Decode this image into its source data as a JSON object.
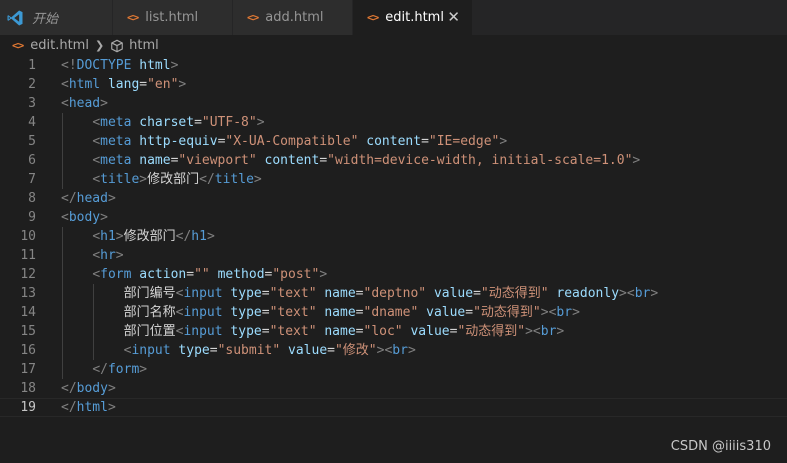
{
  "tabs": [
    {
      "label": "开始",
      "active": false,
      "icon": "vscode-logo-icon"
    },
    {
      "label": "list.html",
      "active": false,
      "icon": "html-file-icon"
    },
    {
      "label": "add.html",
      "active": false,
      "icon": "html-file-icon"
    },
    {
      "label": "edit.html",
      "active": true,
      "icon": "html-file-icon"
    }
  ],
  "breadcrumb": {
    "file": "edit.html",
    "symbol": "html"
  },
  "editor": {
    "current_line": 19,
    "lines": [
      [
        [
          "punc",
          "<!"
        ],
        [
          "tag",
          "DOCTYPE"
        ],
        [
          "text",
          " "
        ],
        [
          "attr",
          "html"
        ],
        [
          "punc",
          ">"
        ]
      ],
      [
        [
          "punc",
          "<"
        ],
        [
          "tag",
          "html"
        ],
        [
          "text",
          " "
        ],
        [
          "attr",
          "lang"
        ],
        [
          "text",
          "="
        ],
        [
          "str",
          "\"en\""
        ],
        [
          "punc",
          ">"
        ]
      ],
      [
        [
          "punc",
          "<"
        ],
        [
          "tag",
          "head"
        ],
        [
          "punc",
          ">"
        ]
      ],
      [
        [
          "text",
          "    "
        ],
        [
          "punc",
          "<"
        ],
        [
          "tag",
          "meta"
        ],
        [
          "text",
          " "
        ],
        [
          "attr",
          "charset"
        ],
        [
          "text",
          "="
        ],
        [
          "str",
          "\"UTF-8\""
        ],
        [
          "punc",
          ">"
        ]
      ],
      [
        [
          "text",
          "    "
        ],
        [
          "punc",
          "<"
        ],
        [
          "tag",
          "meta"
        ],
        [
          "text",
          " "
        ],
        [
          "attr",
          "http-equiv"
        ],
        [
          "text",
          "="
        ],
        [
          "str",
          "\"X-UA-Compatible\""
        ],
        [
          "text",
          " "
        ],
        [
          "attr",
          "content"
        ],
        [
          "text",
          "="
        ],
        [
          "str",
          "\"IE=edge\""
        ],
        [
          "punc",
          ">"
        ]
      ],
      [
        [
          "text",
          "    "
        ],
        [
          "punc",
          "<"
        ],
        [
          "tag",
          "meta"
        ],
        [
          "text",
          " "
        ],
        [
          "attr",
          "name"
        ],
        [
          "text",
          "="
        ],
        [
          "str",
          "\"viewport\""
        ],
        [
          "text",
          " "
        ],
        [
          "attr",
          "content"
        ],
        [
          "text",
          "="
        ],
        [
          "str",
          "\"width=device-width, initial-scale=1.0\""
        ],
        [
          "punc",
          ">"
        ]
      ],
      [
        [
          "text",
          "    "
        ],
        [
          "punc",
          "<"
        ],
        [
          "tag",
          "title"
        ],
        [
          "punc",
          ">"
        ],
        [
          "text",
          "修改部门"
        ],
        [
          "punc",
          "</"
        ],
        [
          "tag",
          "title"
        ],
        [
          "punc",
          ">"
        ]
      ],
      [
        [
          "punc",
          "</"
        ],
        [
          "tag",
          "head"
        ],
        [
          "punc",
          ">"
        ]
      ],
      [
        [
          "punc",
          "<"
        ],
        [
          "tag",
          "body"
        ],
        [
          "punc",
          ">"
        ]
      ],
      [
        [
          "text",
          "    "
        ],
        [
          "punc",
          "<"
        ],
        [
          "tag",
          "h1"
        ],
        [
          "punc",
          ">"
        ],
        [
          "text",
          "修改部门"
        ],
        [
          "punc",
          "</"
        ],
        [
          "tag",
          "h1"
        ],
        [
          "punc",
          ">"
        ]
      ],
      [
        [
          "text",
          "    "
        ],
        [
          "punc",
          "<"
        ],
        [
          "tag",
          "hr"
        ],
        [
          "punc",
          ">"
        ]
      ],
      [
        [
          "text",
          "    "
        ],
        [
          "punc",
          "<"
        ],
        [
          "tag",
          "form"
        ],
        [
          "text",
          " "
        ],
        [
          "attr",
          "action"
        ],
        [
          "text",
          "="
        ],
        [
          "str",
          "\"\""
        ],
        [
          "text",
          " "
        ],
        [
          "attr",
          "method"
        ],
        [
          "text",
          "="
        ],
        [
          "str",
          "\"post\""
        ],
        [
          "punc",
          ">"
        ]
      ],
      [
        [
          "text",
          "        部门编号"
        ],
        [
          "punc",
          "<"
        ],
        [
          "tag",
          "input"
        ],
        [
          "text",
          " "
        ],
        [
          "attr",
          "type"
        ],
        [
          "text",
          "="
        ],
        [
          "str",
          "\"text\""
        ],
        [
          "text",
          " "
        ],
        [
          "attr",
          "name"
        ],
        [
          "text",
          "="
        ],
        [
          "str",
          "\"deptno\""
        ],
        [
          "text",
          " "
        ],
        [
          "attr",
          "value"
        ],
        [
          "text",
          "="
        ],
        [
          "str",
          "\"动态得到\""
        ],
        [
          "text",
          " "
        ],
        [
          "attr",
          "readonly"
        ],
        [
          "punc",
          "><"
        ],
        [
          "tag",
          "br"
        ],
        [
          "punc",
          ">"
        ]
      ],
      [
        [
          "text",
          "        部门名称"
        ],
        [
          "punc",
          "<"
        ],
        [
          "tag",
          "input"
        ],
        [
          "text",
          " "
        ],
        [
          "attr",
          "type"
        ],
        [
          "text",
          "="
        ],
        [
          "str",
          "\"text\""
        ],
        [
          "text",
          " "
        ],
        [
          "attr",
          "name"
        ],
        [
          "text",
          "="
        ],
        [
          "str",
          "\"dname\""
        ],
        [
          "text",
          " "
        ],
        [
          "attr",
          "value"
        ],
        [
          "text",
          "="
        ],
        [
          "str",
          "\"动态得到\""
        ],
        [
          "punc",
          "><"
        ],
        [
          "tag",
          "br"
        ],
        [
          "punc",
          ">"
        ]
      ],
      [
        [
          "text",
          "        部门位置"
        ],
        [
          "punc",
          "<"
        ],
        [
          "tag",
          "input"
        ],
        [
          "text",
          " "
        ],
        [
          "attr",
          "type"
        ],
        [
          "text",
          "="
        ],
        [
          "str",
          "\"text\""
        ],
        [
          "text",
          " "
        ],
        [
          "attr",
          "name"
        ],
        [
          "text",
          "="
        ],
        [
          "str",
          "\"loc\""
        ],
        [
          "text",
          " "
        ],
        [
          "attr",
          "value"
        ],
        [
          "text",
          "="
        ],
        [
          "str",
          "\"动态得到\""
        ],
        [
          "punc",
          "><"
        ],
        [
          "tag",
          "br"
        ],
        [
          "punc",
          ">"
        ]
      ],
      [
        [
          "text",
          "        "
        ],
        [
          "punc",
          "<"
        ],
        [
          "tag",
          "input"
        ],
        [
          "text",
          " "
        ],
        [
          "attr",
          "type"
        ],
        [
          "text",
          "="
        ],
        [
          "str",
          "\"submit\""
        ],
        [
          "text",
          " "
        ],
        [
          "attr",
          "value"
        ],
        [
          "text",
          "="
        ],
        [
          "str",
          "\"修改\""
        ],
        [
          "punc",
          "><"
        ],
        [
          "tag",
          "br"
        ],
        [
          "punc",
          ">"
        ]
      ],
      [
        [
          "text",
          "    "
        ],
        [
          "punc",
          "</"
        ],
        [
          "tag",
          "form"
        ],
        [
          "punc",
          ">"
        ]
      ],
      [
        [
          "punc",
          "</"
        ],
        [
          "tag",
          "body"
        ],
        [
          "punc",
          ">"
        ]
      ],
      [
        [
          "punc",
          "</"
        ],
        [
          "tag",
          "html"
        ],
        [
          "punc",
          ">"
        ]
      ]
    ]
  },
  "watermark": "CSDN @iiiis310",
  "colors": {
    "punc": "#808080",
    "tag": "#569cd6",
    "attr": "#9cdcfe",
    "str": "#ce9178",
    "text": "#d4d4d4",
    "tab_active_bg": "#1e1e1e",
    "tab_bg": "#2d2d2d",
    "html_icon": "#e37933",
    "vscode_blue": "#3c99d4"
  }
}
